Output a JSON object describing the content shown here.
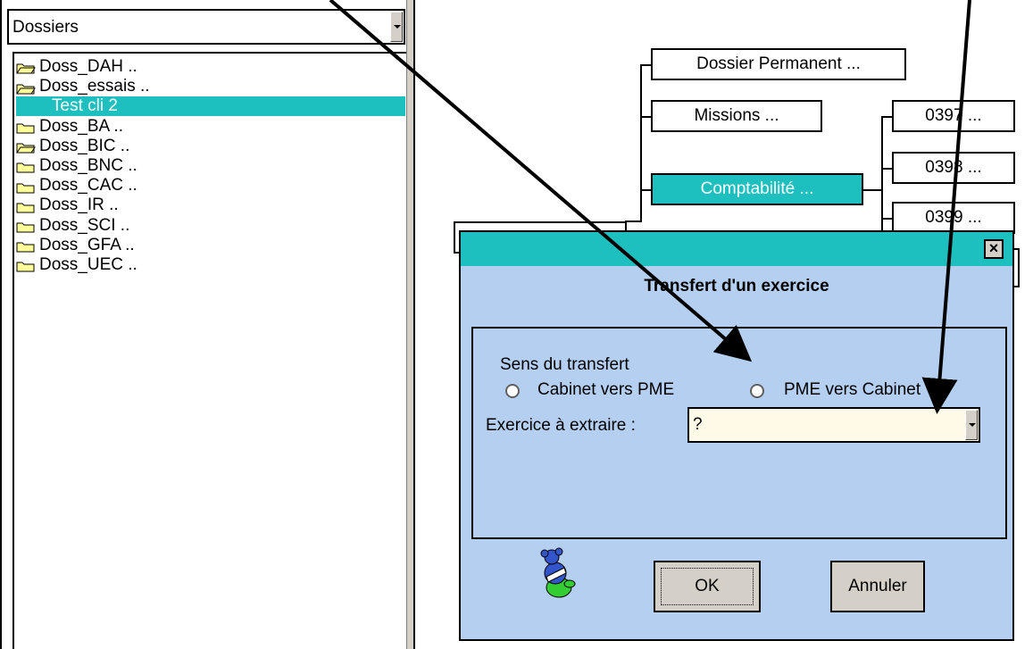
{
  "left": {
    "combo_value": "Dossiers",
    "tree": [
      {
        "label": "Doss_DAH ..",
        "folder": "open"
      },
      {
        "label": "Doss_essais ..",
        "folder": "open"
      },
      {
        "label": "Test cli 2",
        "folder": "none",
        "selected": true
      },
      {
        "label": "Doss_BA ..",
        "folder": "closed"
      },
      {
        "label": "Doss_BIC ..",
        "folder": "open"
      },
      {
        "label": "Doss_BNC ..",
        "folder": "closed"
      },
      {
        "label": "Doss_CAC ..",
        "folder": "closed"
      },
      {
        "label": "Doss_IR ..",
        "folder": "closed"
      },
      {
        "label": "Doss_SCI ..",
        "folder": "closed"
      },
      {
        "label": "Doss_GFA ..",
        "folder": "closed"
      },
      {
        "label": "Doss_UEC ..",
        "folder": "closed"
      }
    ]
  },
  "tree_nodes": {
    "dossier_permanent": "Dossier Permanent ...",
    "missions": "Missions ...",
    "comptabilite": "Comptabilité ...",
    "year_0397": "0397 ...",
    "year_0398": "0398 ...",
    "year_0399": "0399 ..."
  },
  "dialog": {
    "close_label": "×",
    "title": "Transfert d'un exercice",
    "sens_label": "Sens du transfert",
    "option_cabinet_pme": "Cabinet vers PME",
    "option_pme_cabinet": "PME vers Cabinet",
    "exercice_label": "Exercice à extraire :",
    "exercice_value": "?",
    "ok_label": "OK",
    "cancel_label": "Annuler"
  },
  "colors": {
    "accent": "#1ebfbf",
    "dialog_bg": "#b4cff0",
    "button_face": "#d4d0c8",
    "folder": "#ffff99"
  }
}
